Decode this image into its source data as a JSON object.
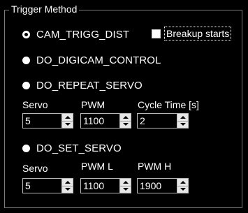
{
  "group": {
    "title": "Trigger Method"
  },
  "options": {
    "cam_trigg_dist": {
      "label": "CAM_TRIGG_DIST",
      "checked": true
    },
    "do_digicam_control": {
      "label": "DO_DIGICAM_CONTROL",
      "checked": false
    },
    "do_repeat_servo": {
      "label": "DO_REPEAT_SERVO",
      "checked": false
    },
    "do_set_servo": {
      "label": "DO_SET_SERVO",
      "checked": false
    }
  },
  "breakup_checkbox": {
    "label": "Breakup starts",
    "checked": false
  },
  "repeat_servo": {
    "servo_label": "Servo",
    "servo_value": "5",
    "pwm_label": "PWM",
    "pwm_value": "1100",
    "cycle_label": "Cycle Time [s]",
    "cycle_value": "2"
  },
  "set_servo": {
    "servo_label": "Servo",
    "servo_value": "5",
    "pwml_label": "PWM L",
    "pwml_value": "1100",
    "pwmh_label": "PWM H",
    "pwmh_value": "1900"
  },
  "icons": {
    "radio_checked": "radio-checked-icon",
    "radio_unchecked": "radio-unchecked-icon",
    "spinner_up": "chevron-up-icon",
    "spinner_down": "chevron-down-icon"
  }
}
